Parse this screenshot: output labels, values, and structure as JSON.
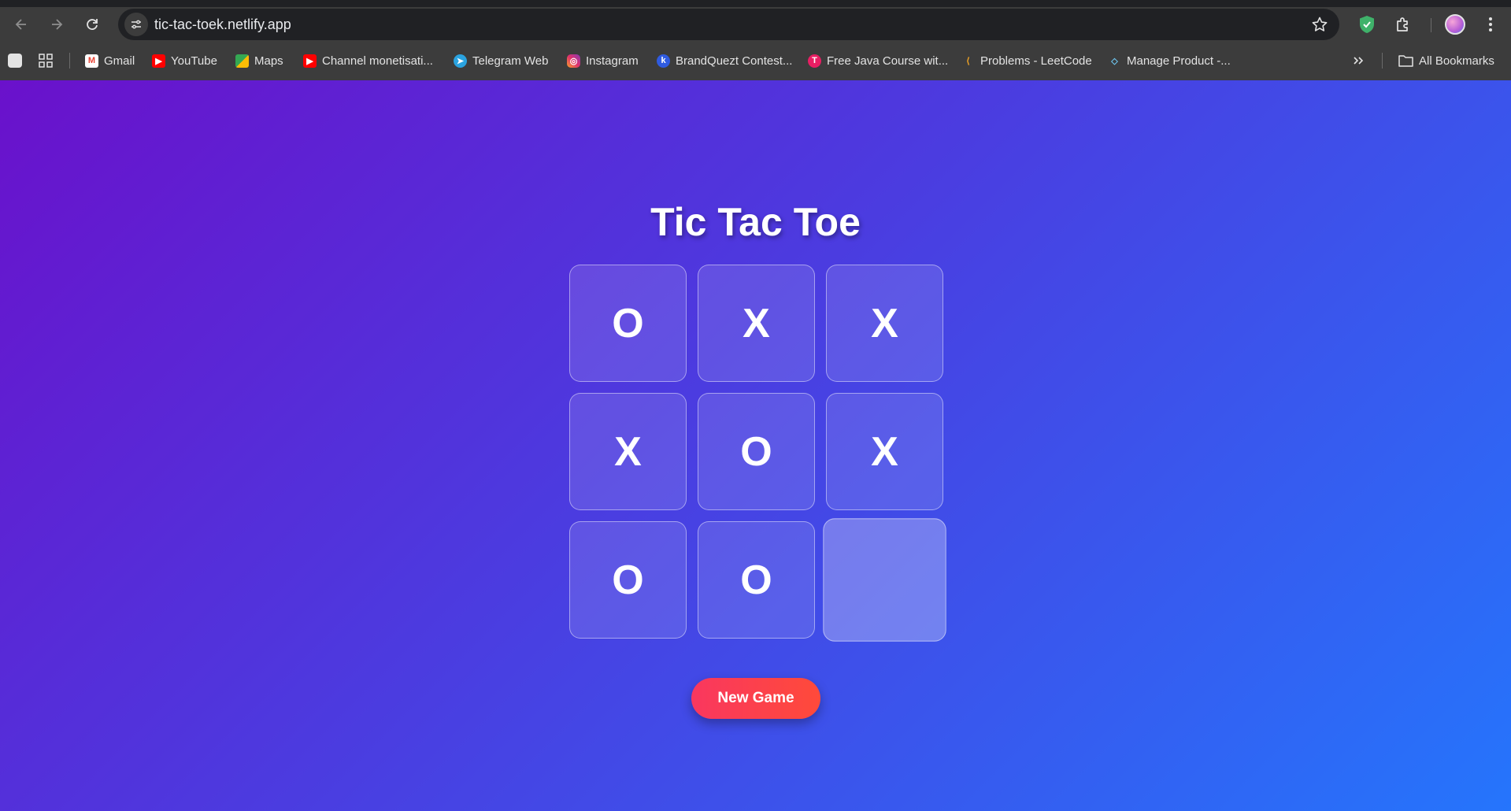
{
  "browser": {
    "url": "tic-tac-toek.netlify.app",
    "bookmarks": [
      {
        "label": "Gmail",
        "icon": "gmail-icon"
      },
      {
        "label": "YouTube",
        "icon": "youtube-icon"
      },
      {
        "label": "Maps",
        "icon": "maps-icon"
      },
      {
        "label": "Channel monetisati...",
        "icon": "youtube-icon"
      },
      {
        "label": "Telegram Web",
        "icon": "telegram-icon"
      },
      {
        "label": "Instagram",
        "icon": "instagram-icon"
      },
      {
        "label": "BrandQuezt Contest...",
        "icon": "brandquezt-icon"
      },
      {
        "label": "Free Java Course wit...",
        "icon": "java-course-icon"
      },
      {
        "label": "Problems - LeetCode",
        "icon": "leetcode-icon"
      },
      {
        "label": "Manage Product -...",
        "icon": "manage-product-icon"
      }
    ],
    "all_bookmarks_label": "All Bookmarks"
  },
  "game": {
    "title": "Tic Tac Toe",
    "cells": [
      "O",
      "X",
      "X",
      "X",
      "O",
      "X",
      "O",
      "O",
      ""
    ],
    "new_game_label": "New Game"
  },
  "colors": {
    "background_start": "#6a11cb",
    "background_end": "#2575fc",
    "button_start": "#f9375f",
    "button_end": "#ff4a3a"
  }
}
